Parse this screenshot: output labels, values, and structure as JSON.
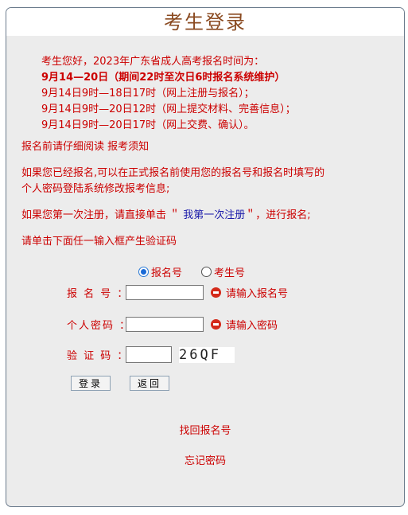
{
  "title": "考生登录",
  "notice": {
    "line1": "考生您好，2023年广东省成人高考报名时间为：",
    "line2": "9月14—20日（期间22时至次日6时报名系统维护）",
    "line3": "9月14日9时—18日17时（网上注册与报名）；",
    "line4": "9月14日9时—20日12时（网上提交材料、完善信息）；",
    "line5": "9月14日9时—20日17时（网上交费、确认）。"
  },
  "read_notice": "报名前请仔细阅读 报考须知",
  "already_registered": {
    "line1": "如果您已经报名,可以在正式报名前使用您的报名号和报名时填写的",
    "line2": "个人密码登陆系统修改报考信息;"
  },
  "first_time": {
    "prefix": "如果您第一次注册，请直接单击 ＂",
    "link": " 我第一次注册",
    "suffix": "＂，进行报名;"
  },
  "captcha_hint": "请单击下面任一输入框产生验证码",
  "login_type": {
    "options": [
      "报名号",
      "考生号"
    ],
    "selected": "报名号"
  },
  "form": {
    "registration_label": "报 名 号 ：",
    "registration_value": "",
    "registration_warning": "请输入报名号",
    "password_label": "个人密码 ：",
    "password_value": "",
    "password_warning": "请输入密码",
    "captcha_label": "验 证 码 ：",
    "captcha_value": "",
    "captcha_image_text": "26QF"
  },
  "buttons": {
    "login": "登录",
    "back": "返回"
  },
  "links": {
    "recover_number": "找回报名号",
    "forgot_password": "忘记密码"
  },
  "colors": {
    "text_red": "#cc0000",
    "title_brown": "#8a4a20",
    "link_blue": "#1a1aaa",
    "panel_bg": "#ececec"
  }
}
